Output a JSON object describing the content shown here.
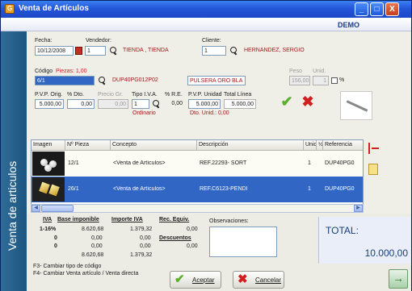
{
  "window": {
    "title": "Venta de Artículos",
    "side_title": "Venta de articulos",
    "brand": "DEMO",
    "minimize": "_",
    "maximize": "□",
    "close": "X"
  },
  "header": {
    "fecha_label": "Fecha:",
    "fecha_value": "10/12/2008",
    "vendedor_label": "Vendedor:",
    "vendedor_code": "1",
    "vendedor_name": "TIENDA , TIENDA",
    "cliente_label": "Cliente:",
    "cliente_code": "1",
    "cliente_name": "HERNANDEZ, SERGIO"
  },
  "item": {
    "codigo_label": "Código",
    "piezas_label": "Piezas: 1,00",
    "codigo_value": "6/1",
    "codigo_ref": "DUP40PG012P02",
    "descripcion": "PULSERA ORO BLA",
    "peso_label": "Peso",
    "peso_value": "156,00",
    "unid_label": "Unid.",
    "unid_value": "1",
    "chk_label": "%",
    "pvp_orig_label": "P.V.P. Orig.",
    "pvp_orig_value": "5.000,00",
    "dto_label": "% Dto.",
    "dto_value": "0,00",
    "precio_gr_label": "Precio Gr.",
    "precio_gr_value": "0,00",
    "tipo_iva_label": "Tipo I.V.A.",
    "tipo_iva_value": "1",
    "tipo_iva_name": "Ordinario",
    "re_label": "% R.E.",
    "re_value": "0,00",
    "pvp_unidad_label": "P.V.P. Unidad",
    "pvp_unidad_value": "5.000,00",
    "total_linea_label": "Total Línea",
    "total_linea_value": "5.000,00",
    "dto_unid_label": "Dto. Unid.: 0,00"
  },
  "grid": {
    "columns": [
      "Imagen",
      "Nº Pieza",
      "Concepto",
      "Descripción",
      "Unid.",
      "½",
      "Referencia"
    ],
    "rows": [
      {
        "pieza": "12/1",
        "concepto": "<Venta de Artículos>",
        "descripcion": "REF.22293- SORT",
        "unid": "1",
        "referencia": "DUP40PG0"
      },
      {
        "pieza": "26/1",
        "concepto": "<Venta de Artículos>",
        "descripcion": "REF.C6123-PENDI",
        "unid": "1",
        "referencia": "DUP40PG0"
      }
    ]
  },
  "taxes": {
    "headers": [
      "IVA",
      "Base imponible",
      "Importe IVA",
      "Rec. Equiv."
    ],
    "rows": [
      [
        "1-16%",
        "8.620,68",
        "1.379,32",
        "0,00"
      ],
      [
        "0",
        "0,00",
        "0,00",
        "Descuentos"
      ],
      [
        "0",
        "0,00",
        "0,00",
        "0,00"
      ],
      [
        "",
        "8.620,68",
        "1.379,32",
        ""
      ]
    ]
  },
  "observaciones_label": "Observaciones:",
  "total_label": "TOTAL:",
  "total_value": "10.000,00",
  "hints": [
    "F3- Cambiar tipo de código",
    "F4- Cambiar Venta artículo / Venta directa"
  ],
  "buttons": {
    "accept": "Aceptar",
    "cancel": "Cancelar"
  }
}
